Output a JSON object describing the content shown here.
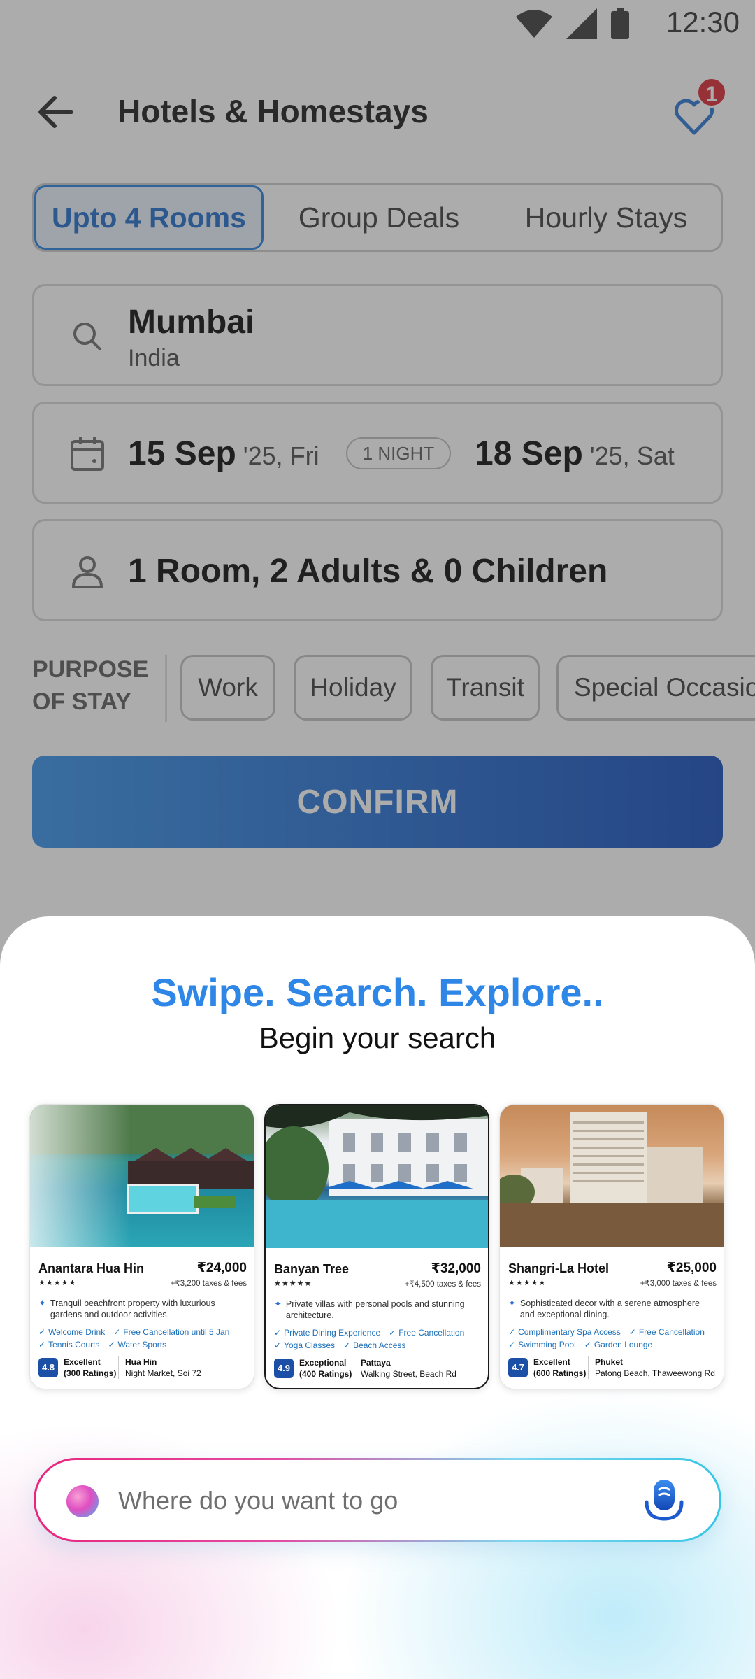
{
  "status_bar": {
    "time": "12:30"
  },
  "header": {
    "title": "Hotels & Homestays",
    "wishlist_count": "1"
  },
  "tabs": [
    {
      "label": "Upto 4 Rooms",
      "active": true
    },
    {
      "label": "Group Deals",
      "active": false
    },
    {
      "label": "Hourly Stays",
      "active": false
    }
  ],
  "destination": {
    "city": "Mumbai",
    "country": "India"
  },
  "dates": {
    "checkin_day": "15 Sep",
    "checkin_rest": " '25, Fri",
    "nights": "1 NIGHT",
    "checkout_day": "18 Sep",
    "checkout_rest": " '25, Sat"
  },
  "guests": {
    "summary": "1 Room, 2 Adults & 0 Children"
  },
  "purpose": {
    "label_line1": "PURPOSE",
    "label_line2": "OF STAY",
    "options": [
      "Work",
      "Holiday",
      "Transit",
      "Special Occasion"
    ]
  },
  "confirm_label": "CONFIRM",
  "sheet": {
    "title": "Swipe. Search. Explore..",
    "subtitle": "Begin your search",
    "search_placeholder": "Where do you want to go",
    "cards": [
      {
        "name": "Anantara Hua Hin",
        "price": "₹24,000",
        "taxes": "+₹3,200 taxes & fees",
        "stars": "★★★★★",
        "description": "Tranquil beachfront property with luxurious gardens and outdoor activities.",
        "amenities_row1": [
          "Welcome Drink",
          "Free Cancellation until 5 Jan"
        ],
        "amenities_row2": [
          "Tennis Courts",
          "Water Sports"
        ],
        "rating": "4.8",
        "rating_label": "Excellent",
        "rating_count": "(300 Ratings)",
        "city": "Hua Hin",
        "address": "Night Market, Soi 72"
      },
      {
        "name": "Banyan Tree",
        "price": "₹32,000",
        "taxes": "+₹4,500 taxes & fees",
        "stars": "★★★★★",
        "description": "Private villas with personal pools and stunning architecture.",
        "amenities_row1": [
          "Private Dining Experience",
          "Free Cancellation"
        ],
        "amenities_row2": [
          "Yoga Classes",
          "Beach Access"
        ],
        "rating": "4.9",
        "rating_label": "Exceptional",
        "rating_count": "(400 Ratings)",
        "city": "Pattaya",
        "address": "Walking Street, Beach Rd"
      },
      {
        "name": "Shangri-La Hotel",
        "price": "₹25,000",
        "taxes": "+₹3,000 taxes & fees",
        "stars": "★★★★★",
        "description": "Sophisticated decor with a serene atmosphere and exceptional dining.",
        "amenities_row1": [
          "Complimentary Spa Access",
          "Free Cancellation"
        ],
        "amenities_row2": [
          "Swimming Pool",
          "Garden Lounge"
        ],
        "rating": "4.7",
        "rating_label": "Excellent",
        "rating_count": "(600 Ratings)",
        "city": "Phuket",
        "address": "Patong Beach, Thaweewong Rd"
      }
    ]
  },
  "colors": {
    "accent": "#1f7ae0",
    "confirm_start": "#2f8de8",
    "confirm_end": "#0a45b8",
    "badge": "#d6202a",
    "title_blue": "#2e86e6"
  },
  "icons": [
    "wifi-icon",
    "signal-icon",
    "battery-icon",
    "back-arrow-icon",
    "heart-icon",
    "search-icon",
    "calendar-icon",
    "person-icon",
    "mic-icon",
    "sparkle-icon",
    "check-icon"
  ]
}
